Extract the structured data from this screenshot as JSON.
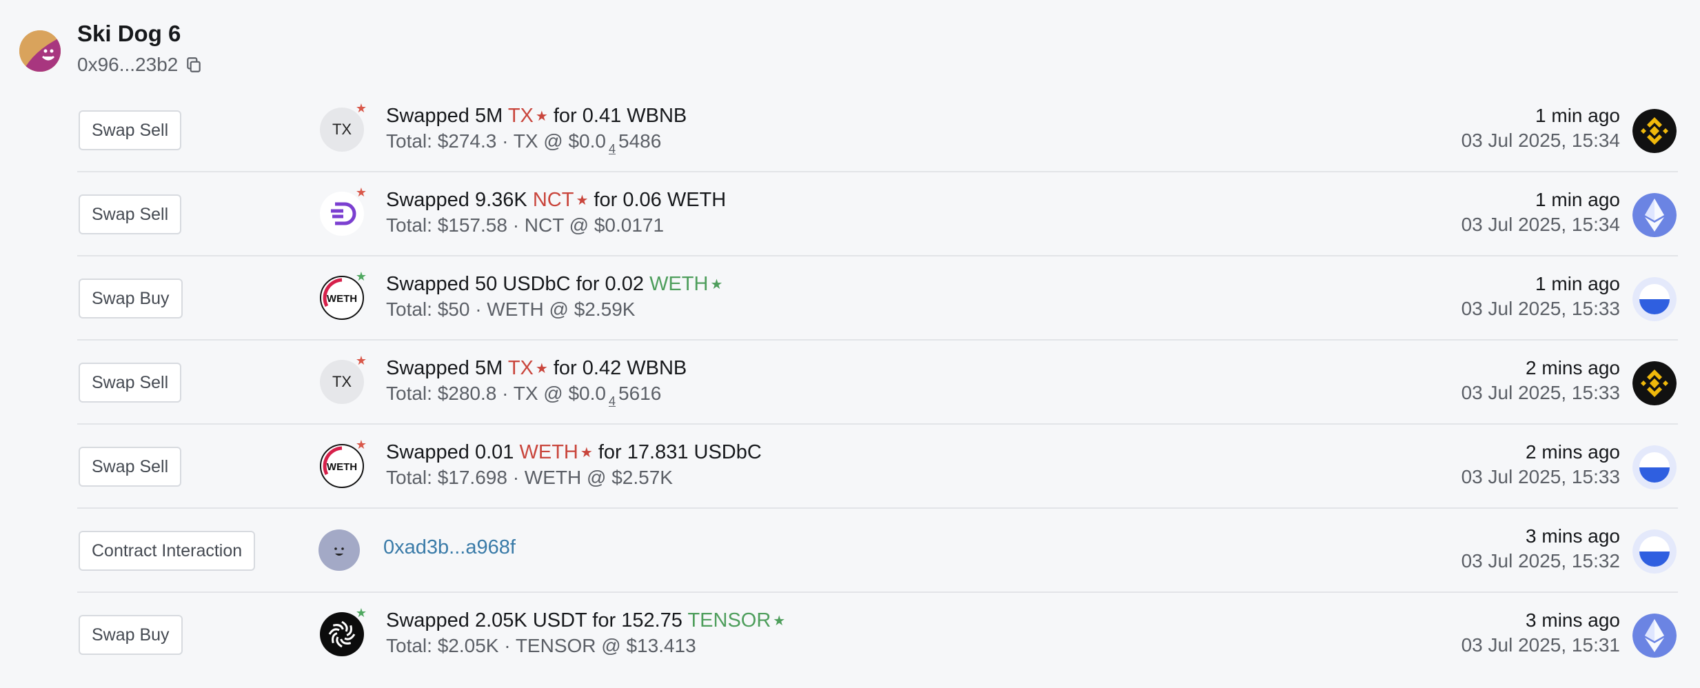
{
  "wallet": {
    "name": "Ski Dog 6",
    "address": "0x96...23b2"
  },
  "colors": {
    "sell_token": "#c9453c",
    "buy_token": "#4e9e5c",
    "link": "#3a7ba8"
  },
  "rows": [
    {
      "type_label": "Swap Sell",
      "token_icon": "tx-token-icon",
      "line1_pre": "Swapped 5M ",
      "line1_token": "TX",
      "line1_post": " for 0.41 WBNB",
      "line2_pre": "Total: $274.3 · TX @ $0.0",
      "line2_sub": "4",
      "line2_post": "5486",
      "ago": "1 min ago",
      "date": "03 Jul 2025, 15:34",
      "chain": "bnb-chain-icon"
    },
    {
      "type_label": "Swap Sell",
      "token_icon": "nct-token-icon",
      "line1_pre": "Swapped 9.36K ",
      "line1_token": "NCT",
      "line1_post": " for 0.06 WETH",
      "line2": "Total: $157.58 · NCT @ $0.0171",
      "ago": "1 min ago",
      "date": "03 Jul 2025, 15:34",
      "chain": "ethereum-chain-icon"
    },
    {
      "type_label": "Swap Buy",
      "token_icon": "weth-token-icon",
      "line1_pre": "Swapped 50 USDbC for 0.02 ",
      "line1_token": "WETH",
      "line2": "Total: $50 · WETH @ $2.59K",
      "ago": "1 min ago",
      "date": "03 Jul 2025, 15:33",
      "chain": "base-chain-icon"
    },
    {
      "type_label": "Swap Sell",
      "token_icon": "tx-token-icon",
      "line1_pre": "Swapped 5M ",
      "line1_token": "TX",
      "line1_post": " for 0.42 WBNB",
      "line2_pre": "Total: $280.8 · TX @ $0.0",
      "line2_sub": "4",
      "line2_post": "5616",
      "ago": "2 mins ago",
      "date": "03 Jul 2025, 15:33",
      "chain": "bnb-chain-icon"
    },
    {
      "type_label": "Swap Sell",
      "token_icon": "weth-token-icon",
      "line1_pre": "Swapped 0.01 ",
      "line1_token": "WETH",
      "line1_post": " for 17.831 USDbC",
      "line2": "Total: $17.698 · WETH @ $2.57K",
      "ago": "2 mins ago",
      "date": "03 Jul 2025, 15:33",
      "chain": "base-chain-icon"
    },
    {
      "type_label": "Contract Interaction",
      "token_icon": "contract-avatar-icon",
      "contract": "0xad3b...a968f",
      "ago": "3 mins ago",
      "date": "03 Jul 2025, 15:32",
      "chain": "base-chain-icon"
    },
    {
      "type_label": "Swap Buy",
      "token_icon": "tensor-token-icon",
      "line1_pre": "Swapped 2.05K USDT for 152.75 ",
      "line1_token": "TENSOR",
      "line2": "Total: $2.05K · TENSOR @ $13.413",
      "ago": "3 mins ago",
      "date": "03 Jul 2025, 15:31",
      "chain": "ethereum-chain-icon"
    }
  ]
}
